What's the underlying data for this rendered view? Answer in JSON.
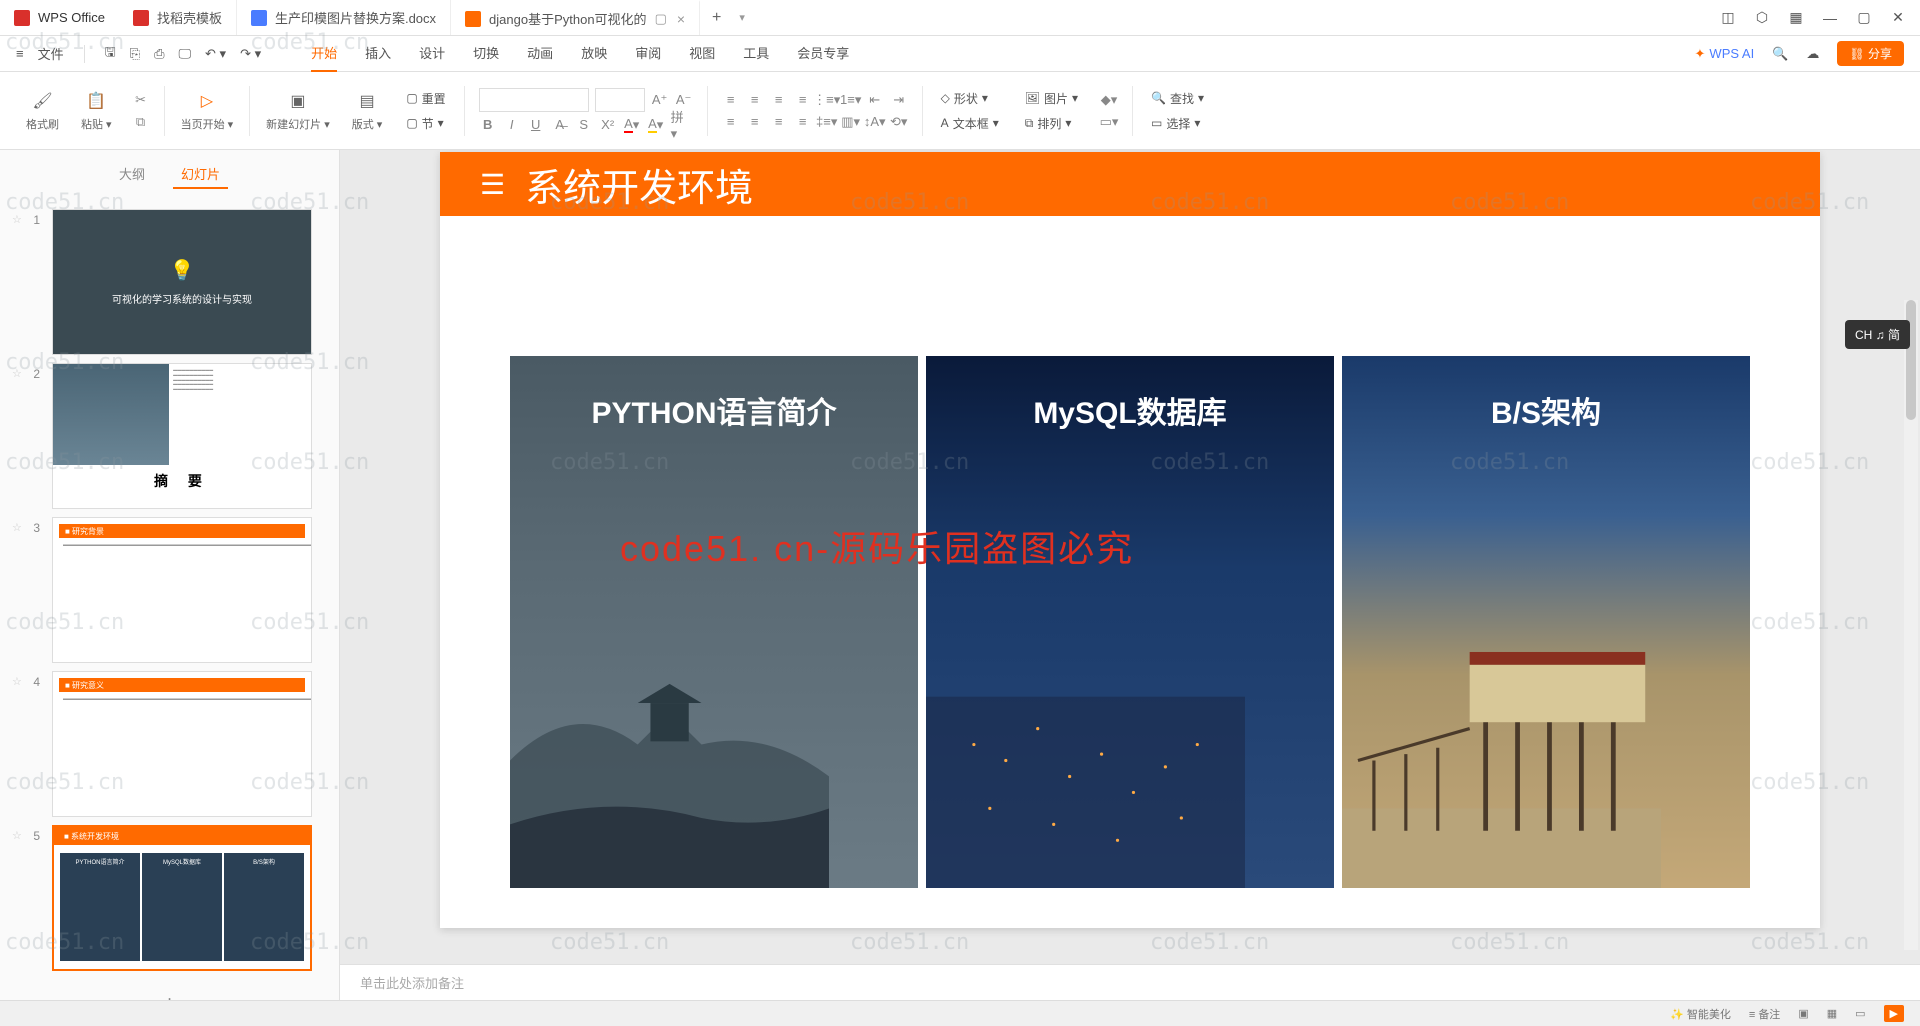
{
  "app": {
    "name": "WPS Office"
  },
  "tabs": [
    {
      "icon_color": "#d9302b",
      "label": "找稻壳模板"
    },
    {
      "icon_color": "#4a7cff",
      "label": "生产印模图片替换方案.docx"
    },
    {
      "icon_color": "#ff6a00",
      "label": "django基于Python可视化的",
      "active": true
    }
  ],
  "menubar": {
    "file": "文件",
    "tabs": [
      "开始",
      "插入",
      "设计",
      "切换",
      "动画",
      "放映",
      "审阅",
      "视图",
      "工具",
      "会员专享"
    ],
    "active_tab": "开始",
    "wps_ai": "WPS AI",
    "share": "分享"
  },
  "ribbon": {
    "format_painter": "格式刷",
    "paste": "粘贴",
    "from_current": "当页开始",
    "new_slide": "新建幻灯片",
    "layout": "版式",
    "reset": "重置",
    "section": "节",
    "shape": "形状",
    "picture": "图片",
    "textbox": "文本框",
    "arrange": "排列",
    "find": "查找",
    "select": "选择"
  },
  "sidebar": {
    "tab_outline": "大纲",
    "tab_slides": "幻灯片",
    "thumbs": {
      "t1_text": "可视化的学习系统的设计与实现",
      "t2_title": "摘    要",
      "t3_bar": "■ 研究背景",
      "t4_bar": "■ 研究意义",
      "t5_bar": "■ 系统开发环境",
      "t5_c1": "PYTHON语言简介",
      "t5_c2": "MySQL数据库",
      "t5_c3": "B/S架构"
    }
  },
  "slide": {
    "title": "系统开发环境",
    "card1": "PYTHON语言简介",
    "card2": "MySQL数据库",
    "card3": "B/S架构"
  },
  "notes_placeholder": "单击此处添加备注",
  "watermark_text": "code51.cn",
  "watermark_red": "code51. cn-源码乐园盗图必究",
  "ime_badge": "CH ♫ 简",
  "statusbar": {
    "smart_beautify": "智能美化",
    "notes": "备注"
  }
}
